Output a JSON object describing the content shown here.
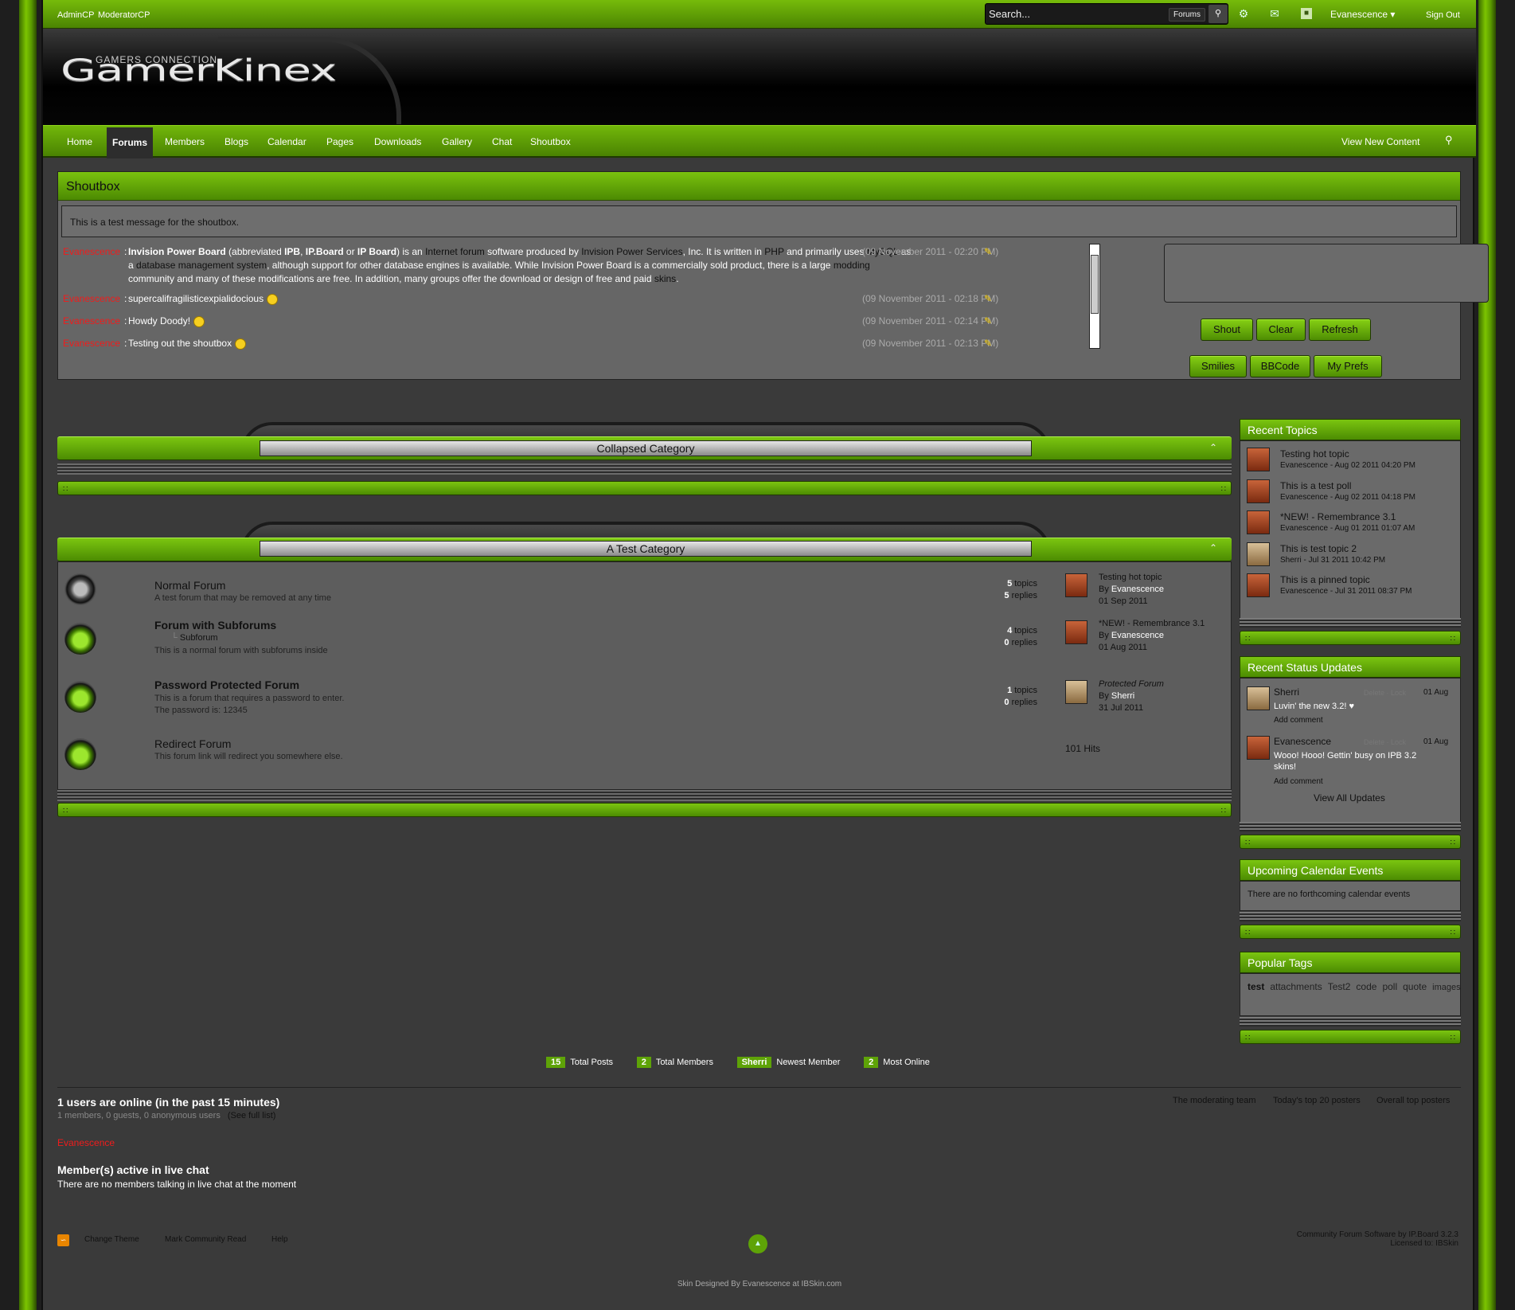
{
  "topbar": {
    "links": [
      "AdminCP",
      "ModeratorCP"
    ],
    "search_placeholder": "Search...",
    "search_scope": "Forums",
    "user_menu": "Evanescence",
    "sign_out": "Sign Out"
  },
  "header": {
    "logo": "GamerKinex",
    "logo_sub": "GAMERS CONNECTION"
  },
  "nav": {
    "items": [
      "Home",
      "Forums",
      "Members",
      "Blogs",
      "Calendar",
      "Pages",
      "Downloads",
      "Gallery",
      "Chat",
      "Shoutbox"
    ],
    "active": "Forums",
    "view_new": "View New Content"
  },
  "shoutbox": {
    "title": "Shoutbox",
    "announcement": "This is a test message for the shoutbox.",
    "shouts": [
      {
        "user": "Evanescence",
        "text_parts": [
          {
            "b": "Invision Power Board"
          },
          {
            "t": " (abbreviated "
          },
          {
            "b": "IPB"
          },
          {
            "t": ", "
          },
          {
            "b": "IP.Board"
          },
          {
            "t": " or "
          },
          {
            "b": "IP Board"
          },
          {
            "t": ") is an "
          },
          {
            "d": "Internet"
          },
          {
            "t": " "
          },
          {
            "d": "forum"
          },
          {
            "t": " software produced by "
          },
          {
            "d": "Invision Power Services"
          },
          {
            "t": ", Inc. It is written in "
          },
          {
            "d": "PHP"
          },
          {
            "t": " and primarily uses "
          },
          {
            "d": "MySQL"
          },
          {
            "t": " as a "
          },
          {
            "d": "database management system"
          },
          {
            "t": ", although support for other database engines is available. While Invision Power Board is a commercially sold product, there is a large "
          },
          {
            "d": "modding"
          },
          {
            "t": " community and many of these modifications are free. In addition, many groups offer the download or design of free and paid "
          },
          {
            "d": "skins"
          },
          {
            "t": "."
          }
        ],
        "date": "(09 November 2011 - 02:20 PM)"
      },
      {
        "user": "Evanescence",
        "text": "supercalifragilisticexpialidocious",
        "date": "(09 November 2011 - 02:18 PM)"
      },
      {
        "user": "Evanescence",
        "text": "Howdy Doody!",
        "date": "(09 November 2011 - 02:14 PM)"
      },
      {
        "user": "Evanescence",
        "text": "Testing out the shoutbox",
        "date": "(09 November 2011 - 02:13 PM)"
      }
    ],
    "buttons": {
      "shout": "Shout",
      "clear": "Clear",
      "refresh": "Refresh",
      "smilies": "Smilies",
      "bbcode": "BBCode",
      "prefs": "My Prefs"
    }
  },
  "categories": {
    "collapsed": {
      "title": "Collapsed Category"
    },
    "test": {
      "title": "A Test Category",
      "forums": [
        {
          "name": "Normal Forum",
          "desc": "A test forum that may be removed at any time",
          "topics": "5",
          "replies": "5",
          "last_title": "Testing hot topic",
          "last_by": "Evanescence",
          "last_date": "01 Sep 2011"
        },
        {
          "name": "Forum with Subforums",
          "sub": "Subforum",
          "desc": "This is a normal forum with subforums inside",
          "topics": "4",
          "replies": "0",
          "last_title": "*NEW! - Remembrance 3.1",
          "last_by": "Evanescence",
          "last_date": "01 Aug 2011"
        },
        {
          "name": "Password Protected Forum",
          "desc": "This is a forum that requires a password to enter.",
          "desc2": "The password is: 12345",
          "topics": "1",
          "replies": "0",
          "last_title": "Protected Forum",
          "last_by": "Sherri",
          "last_date": "31 Jul 2011"
        },
        {
          "name": "Redirect Forum",
          "desc": "This forum link will redirect you somewhere else.",
          "hits": "101 Hits"
        }
      ]
    }
  },
  "labels": {
    "topics": "topics",
    "replies": "replies",
    "by": "By"
  },
  "sidebar": {
    "recent_topics": {
      "title": "Recent Topics",
      "items": [
        {
          "title": "Testing hot topic",
          "meta": "Evanescence - Aug 02 2011 04:20 PM"
        },
        {
          "title": "This is a test poll",
          "meta": "Evanescence - Aug 02 2011 04:18 PM"
        },
        {
          "title": "*NEW! - Remembrance 3.1",
          "meta": "Evanescence - Aug 01 2011 01:07 AM"
        },
        {
          "title": "This is test topic 2",
          "meta": "Sherri - Jul 31 2011 10:42 PM"
        },
        {
          "title": "This is a pinned topic",
          "meta": "Evanescence - Jul 31 2011 08:37 PM"
        }
      ]
    },
    "status": {
      "title": "Recent Status Updates",
      "items": [
        {
          "name": "Sherri",
          "date": "01 Aug",
          "text": "Luvin' the new 3.2! ♥",
          "add": "Add comment"
        },
        {
          "name": "Evanescence",
          "date": "01 Aug",
          "text": "Wooo! Hooo! Gettin' busy on IPB 3.2 skins!",
          "add": "Add comment"
        }
      ],
      "actions": "Delete · Lock",
      "view_all": "View All Updates"
    },
    "calendar": {
      "title": "Upcoming Calendar Events",
      "empty": "There are no forthcoming calendar events"
    },
    "tags": {
      "title": "Popular Tags",
      "items": [
        "test",
        "attachments",
        "Test2",
        "code",
        "poll",
        "quote",
        "images"
      ]
    }
  },
  "stats": [
    {
      "value": "15",
      "label": "Total Posts"
    },
    {
      "value": "2",
      "label": "Total Members"
    },
    {
      "value": "Sherri",
      "label": "Newest Member"
    },
    {
      "value": "2",
      "label": "Most Online"
    }
  ],
  "online": {
    "title": "1 users are online (in the past 15 minutes)",
    "sub": "1 members, 0 guests, 0 anonymous users",
    "full_list": "(See full list)",
    "user": "Evanescence",
    "links": [
      "The moderating team",
      "Today's top 20 posters",
      "Overall top posters"
    ],
    "chat_title": "Member(s) active in live chat",
    "chat_text": "There are no members talking in live chat at the moment"
  },
  "footer": {
    "links": [
      "Change Theme",
      "Mark Community Read",
      "Help"
    ],
    "credit1": "Community Forum Software by IP.Board 3.2.3",
    "credit2": "Licensed to: IBSkin",
    "skin_credit": "Skin Designed By Evanescence at IBSkin.com"
  },
  "colors": {
    "accent": "#5ea307",
    "username": "#f01c1c",
    "page_bg": "#3a3a3a"
  }
}
